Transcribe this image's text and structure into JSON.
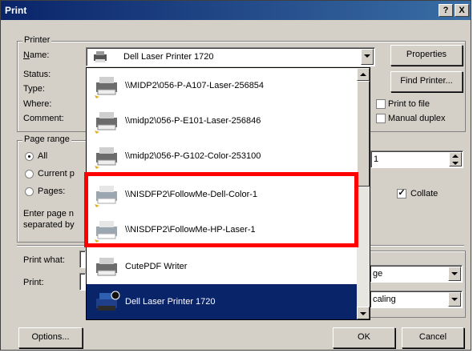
{
  "window": {
    "title": "Print",
    "help_btn": "?",
    "close_btn": "X"
  },
  "printer": {
    "group_label": "Printer",
    "name_label": "Name:",
    "status_label": "Status:",
    "type_label": "Type:",
    "where_label": "Where:",
    "comment_label": "Comment:",
    "selected_printer": "Dell Laser Printer 1720",
    "properties_btn": "Properties",
    "find_printer_btn": "Find Printer...",
    "print_to_file": "Print to file",
    "manual_duplex": "Manual duplex"
  },
  "page_range": {
    "group_label": "Page range",
    "all": "All",
    "current_page": "Current p",
    "pages": "Pages:",
    "hint_line1": "Enter page n",
    "hint_line2": "separated by"
  },
  "copies": {
    "value": "1",
    "collate": "Collate"
  },
  "print_what": {
    "label": "Print what:",
    "value": ""
  },
  "print": {
    "label": "Print:",
    "value": ""
  },
  "zoom": {
    "pages_per_sheet_value": "ge",
    "scale_value": "caling"
  },
  "buttons": {
    "options": "Options...",
    "ok": "OK",
    "cancel": "Cancel"
  },
  "dropdown": {
    "items": [
      {
        "name": "\\\\MIDP2\\056-P-A107-Laser-256854",
        "icon": "network-printer-icon"
      },
      {
        "name": "\\\\midp2\\056-P-E101-Laser-256846",
        "icon": "network-printer-icon"
      },
      {
        "name": "\\\\midp2\\056-P-G102-Color-253100",
        "icon": "network-printer-icon"
      },
      {
        "name": "\\\\NISDFP2\\FollowMe-Dell-Color-1",
        "icon": "network-printer-icon"
      },
      {
        "name": "\\\\NISDFP2\\FollowMe-HP-Laser-1",
        "icon": "network-printer-icon"
      },
      {
        "name": "CutePDF Writer",
        "icon": "printer-icon"
      },
      {
        "name": "Dell Laser Printer 1720",
        "icon": "default-printer-icon"
      }
    ],
    "highlight_color": "#ff0000",
    "selection_color": "#0a246a"
  }
}
